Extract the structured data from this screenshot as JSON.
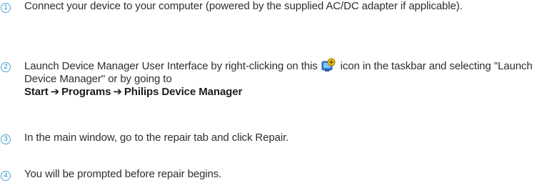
{
  "steps": [
    {
      "number": "1",
      "text": "Connect your device to your computer (powered by the supplied AC/DC adapter if applicable)."
    },
    {
      "number": "2",
      "text_before_icon": "Launch Device Manager User Interface by right-clicking on this",
      "icon": "device-manager-icon",
      "text_after_icon": "icon in the taskbar and selecting \"Launch Device Manager\" or by going to",
      "path": [
        "Start",
        "Programs",
        "Philips Device Manager"
      ],
      "path_separator": "➔"
    },
    {
      "number": "3",
      "text": "In the main window, go to the repair tab and click Repair."
    },
    {
      "number": "4",
      "text": "You will be prompted before repair begins."
    }
  ],
  "colors": {
    "step_number": "#2a86c4",
    "text": "#2e2e2e"
  }
}
